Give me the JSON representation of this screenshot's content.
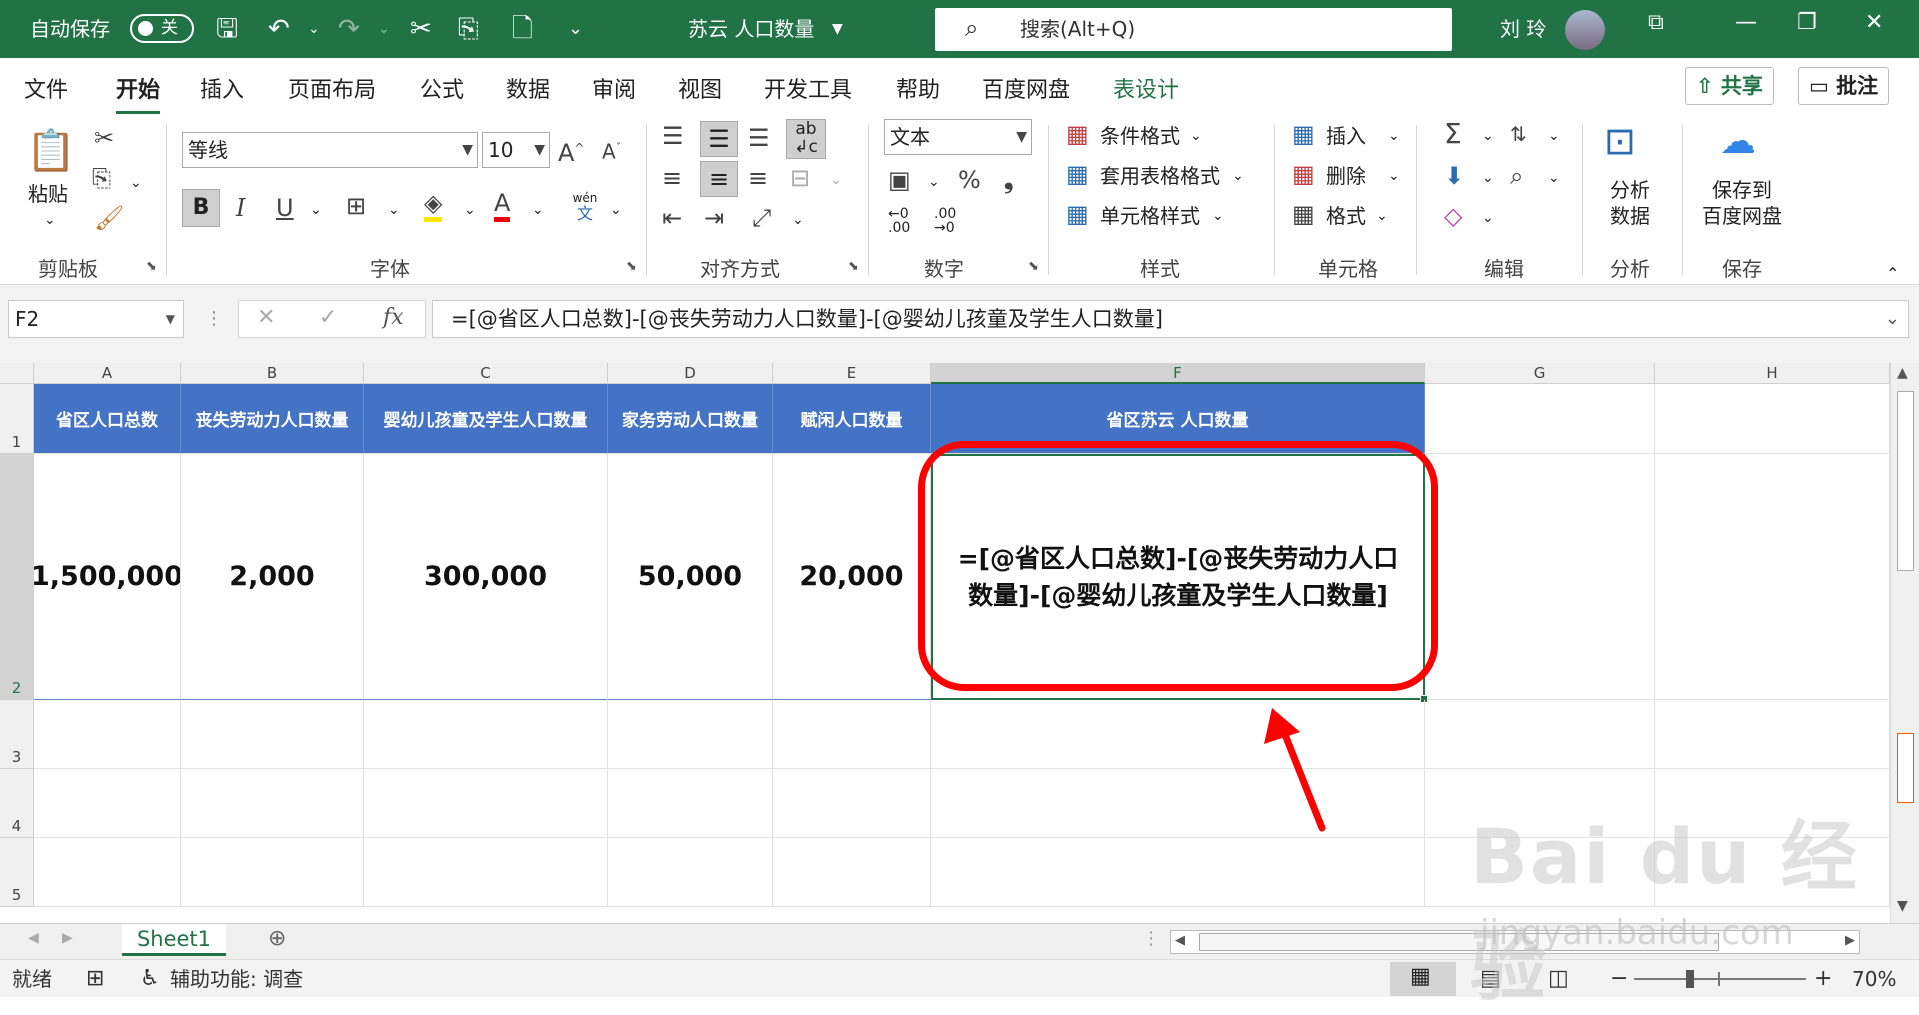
{
  "titlebar": {
    "autosave_label": "自动保存",
    "autosave_state": "关",
    "doc_title": "苏云 人口数量",
    "search_placeholder": "搜索(Alt+Q)",
    "user_name": "刘 玲"
  },
  "tabs": [
    "文件",
    "开始",
    "插入",
    "页面布局",
    "公式",
    "数据",
    "审阅",
    "视图",
    "开发工具",
    "帮助",
    "百度网盘",
    "表设计"
  ],
  "active_tab": "开始",
  "share_label": "共享",
  "comments_label": "批注",
  "ribbon": {
    "clipboard": {
      "paste": "粘贴",
      "group": "剪贴板"
    },
    "font": {
      "name": "等线",
      "size": "10",
      "bold": "B",
      "italic": "I",
      "underline": "U",
      "wen": "wén",
      "wen_char": "文",
      "group": "字体"
    },
    "alignment": {
      "group": "对齐方式"
    },
    "number": {
      "format": "文本",
      "group": "数字"
    },
    "styles": {
      "cond": "条件格式",
      "table": "套用表格格式",
      "cell": "单元格样式",
      "group": "样式"
    },
    "cells": {
      "insert": "插入",
      "delete": "删除",
      "format": "格式",
      "group": "单元格"
    },
    "editing": {
      "group": "编辑"
    },
    "analysis": {
      "btn_line1": "分析",
      "btn_line2": "数据",
      "group": "分析"
    },
    "save": {
      "btn_line1": "保存到",
      "btn_line2": "百度网盘",
      "group": "保存"
    }
  },
  "formula_bar": {
    "name_box": "F2",
    "formula": "=[@省区人口总数]-[@丧失劳动力人口数量]-[@婴幼儿孩童及学生人口数量]"
  },
  "columns": [
    "A",
    "B",
    "C",
    "D",
    "E",
    "F",
    "G",
    "H"
  ],
  "rows": [
    "1",
    "2",
    "3",
    "4",
    "5"
  ],
  "table": {
    "headers": [
      "省区人口总数",
      "丧失劳动力人口数量",
      "婴幼儿孩童及学生人口数量",
      "家务劳动人口数量",
      "赋闲人口数量",
      "省区苏云 人口数量"
    ],
    "row2": [
      "1,500,000",
      "2,000",
      "300,000",
      "50,000",
      "20,000",
      "=[@省区人口总数]-[@丧失劳动力人口数量]-[@婴幼儿孩童及学生人口数量]"
    ]
  },
  "sheet_tab": "Sheet1",
  "status": {
    "mode": "就绪",
    "accessibility": "辅助功能: 调查",
    "zoom": "70%"
  },
  "watermark": {
    "text": "Bai du 经验",
    "url": "jingyan.baidu.com"
  },
  "colors": {
    "excel_green": "#217346",
    "header_blue": "#4472c4",
    "annotation_red": "#ff0000"
  }
}
